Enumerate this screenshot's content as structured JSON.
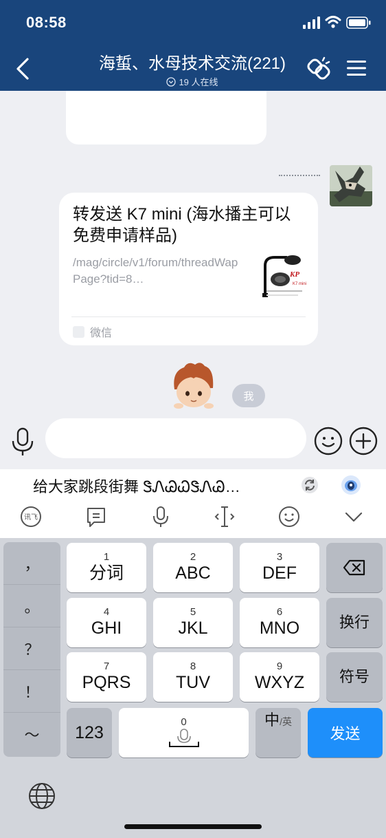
{
  "status": {
    "time": "08:58"
  },
  "header": {
    "title": "海蜇、水母技术交流(221)",
    "online": "19 人在线"
  },
  "messages": {
    "share": {
      "title": "转发送 K7 mini (海水播主可以免费申请样品)",
      "url": "/mag/circle/v1/forum/threadWapPage?tid=8…",
      "source": "微信"
    },
    "me_badge": "我"
  },
  "input": {
    "value": ""
  },
  "ime": {
    "suggestion": "给大家跳段街舞 ᏕᏁᏊᏇᏕᏁᏊ…",
    "keys": [
      {
        "num": "1",
        "label": "分词"
      },
      {
        "num": "2",
        "label": "ABC"
      },
      {
        "num": "3",
        "label": "DEF"
      },
      {
        "num": "4",
        "label": "GHI"
      },
      {
        "num": "5",
        "label": "JKL"
      },
      {
        "num": "6",
        "label": "MNO"
      },
      {
        "num": "7",
        "label": "PQRS"
      },
      {
        "num": "8",
        "label": "TUV"
      },
      {
        "num": "9",
        "label": "WXYZ"
      },
      {
        "num": "0",
        "label": ""
      }
    ],
    "punctuation": [
      "，",
      "。",
      "？",
      "！",
      "～"
    ],
    "newline": "换行",
    "symbols": "符号",
    "numbers": "123",
    "lang_main": "中",
    "lang_alt": "/英",
    "send": "发送"
  },
  "icons": [
    "back-icon",
    "unlink-icon",
    "menu-icon",
    "voice-icon",
    "emoji-icon",
    "plus-icon",
    "refresh-icon",
    "ai-assistant-icon",
    "handwrite-icon",
    "quick-phrase-icon",
    "microphone-icon",
    "cursor-icon",
    "emoji-panel-icon",
    "collapse-icon",
    "backspace-icon",
    "globe-icon"
  ],
  "colors": {
    "header": "#19457c",
    "send": "#1e8ffa",
    "chat_bg": "#eeeff3",
    "keyboard_bg": "#d2d5db"
  }
}
